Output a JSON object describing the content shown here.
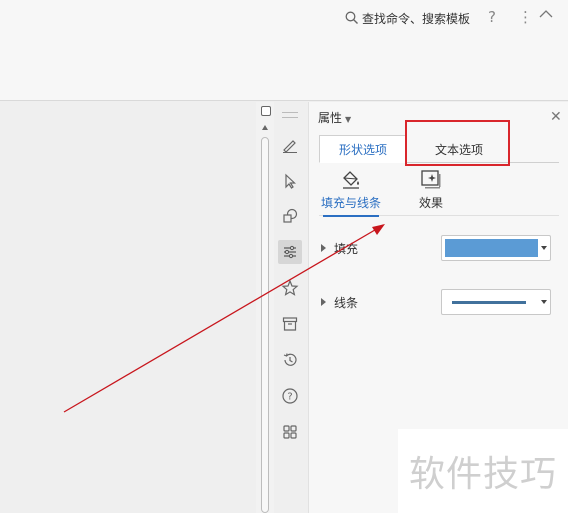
{
  "header": {
    "search_label": "查找命令、搜索模板",
    "icons": [
      "search-icon",
      "help-icon",
      "more-icon",
      "collapse-icon"
    ]
  },
  "panel": {
    "title": "属性",
    "tabs": [
      {
        "label": "形状选项",
        "active": true
      },
      {
        "label": "文本选项",
        "active": false
      }
    ],
    "subtabs": [
      {
        "label": "填充与线条",
        "icon": "fill-bucket-icon",
        "active": true
      },
      {
        "label": "效果",
        "icon": "effect-icon",
        "active": false
      }
    ],
    "rows": [
      {
        "label": "填充",
        "control": "fill-color-dropdown"
      },
      {
        "label": "线条",
        "control": "line-style-dropdown"
      }
    ]
  },
  "toolstrip": {
    "tools": [
      "edit-icon",
      "select-icon",
      "shapes-icon",
      "properties-icon",
      "favorite-icon",
      "archive-icon",
      "history-icon",
      "help-icon",
      "apps-icon"
    ]
  },
  "watermark": "软件技巧",
  "colors": {
    "accent": "#2b6fc2",
    "fill_swatch": "#5b9bd5",
    "line_swatch": "#41719c",
    "annotation": "#d9262c"
  }
}
